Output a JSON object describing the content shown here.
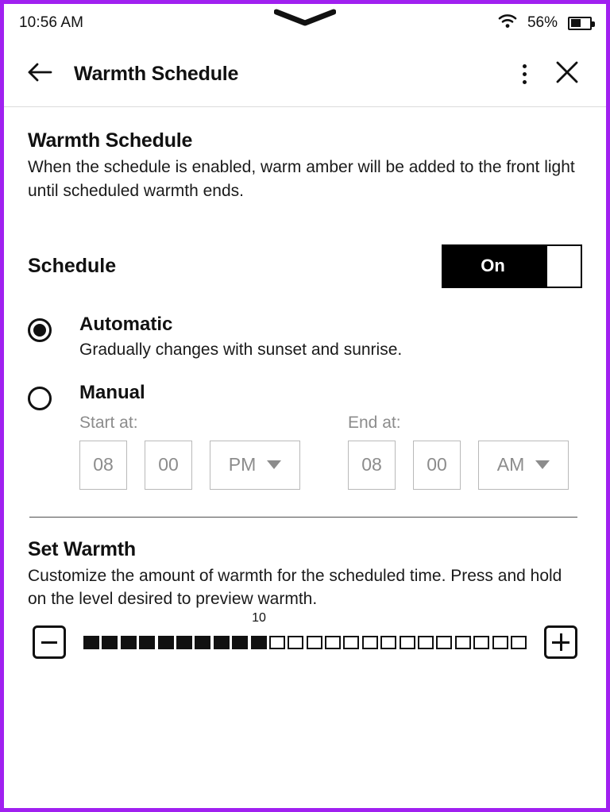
{
  "theme": {
    "frame_border_color": "#a020f0",
    "ink_color": "#111111",
    "muted_color": "#8c8c8c",
    "background": "#ffffff"
  },
  "status_bar": {
    "time": "10:56 AM",
    "battery_percent_label": "56%",
    "battery_level": 56,
    "wifi_icon": "wifi-icon",
    "battery_icon": "battery-icon",
    "pull_handle_icon": "chevron-down-icon"
  },
  "header": {
    "back_icon": "arrow-left-icon",
    "title": "Warmth Schedule",
    "overflow_icon": "more-vertical-icon",
    "close_icon": "close-icon"
  },
  "intro": {
    "title": "Warmth Schedule",
    "description": "When the schedule is enabled, warm amber will be added to the front light until scheduled warmth ends."
  },
  "schedule": {
    "label": "Schedule",
    "toggle_state_label": "On",
    "toggle_on": true
  },
  "options": [
    {
      "id": "automatic",
      "title": "Automatic",
      "description": "Gradually changes with sunset and sunrise.",
      "selected": true
    },
    {
      "id": "manual",
      "title": "Manual",
      "description": "",
      "selected": false
    }
  ],
  "time_pickers": [
    {
      "id": "start",
      "label": "Start at:",
      "hour": "08",
      "minute": "00",
      "meridiem": "PM",
      "meridiem_options": [
        "AM",
        "PM"
      ]
    },
    {
      "id": "end",
      "label": "End at:",
      "hour": "08",
      "minute": "00",
      "meridiem": "AM",
      "meridiem_options": [
        "AM",
        "PM"
      ]
    }
  ],
  "warmth": {
    "title": "Set Warmth",
    "description": "Customize the amount of warmth for the scheduled time. Press and hold on the level desired to preview warmth.",
    "value_label": "10",
    "value": 10,
    "max": 24,
    "decrease_icon": "minus-icon",
    "increase_icon": "plus-icon"
  }
}
